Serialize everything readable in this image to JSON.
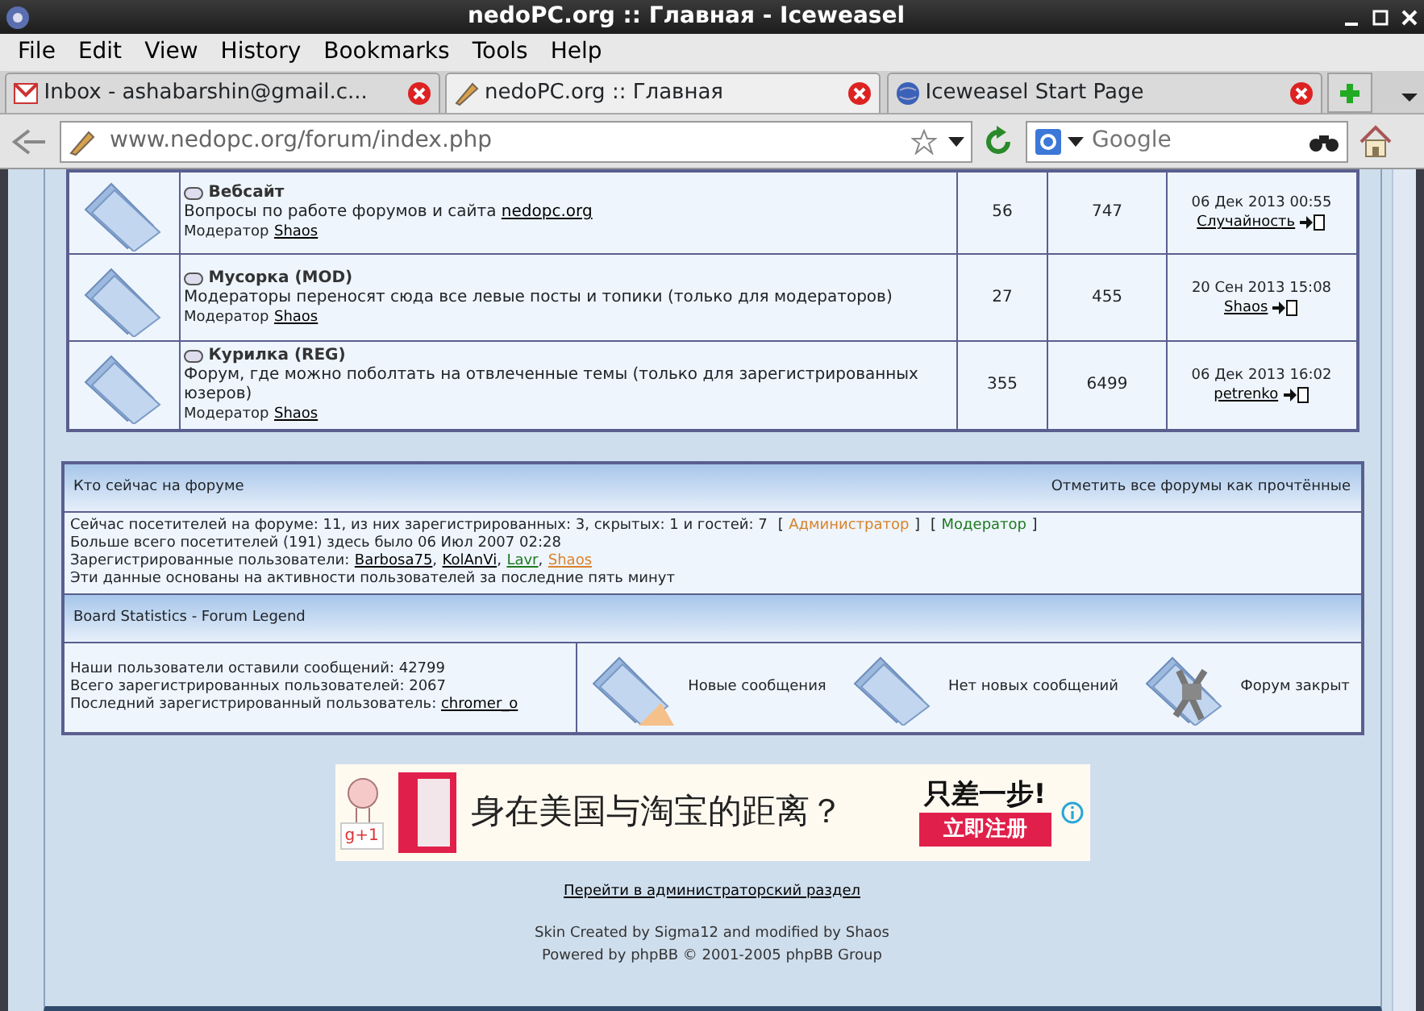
{
  "window": {
    "title": "nedoPC.org :: Главная - Iceweasel"
  },
  "menu": [
    "File",
    "Edit",
    "View",
    "History",
    "Bookmarks",
    "Tools",
    "Help"
  ],
  "tabs": [
    {
      "label": "Inbox - ashabarshin@gmail.c...",
      "selected": false,
      "kind": "mail"
    },
    {
      "label": "nedoPC.org :: Главная",
      "selected": true,
      "kind": "site"
    },
    {
      "label": "Iceweasel Start Page",
      "selected": false,
      "kind": "globe"
    }
  ],
  "address": {
    "value": "www.nedopc.org/forum/index.php"
  },
  "search": {
    "placeholder": "Google"
  },
  "forums": [
    {
      "title": "Вебсайт",
      "description": "Вопросы по работе форумов и сайта ",
      "description_link": "nedopc.org",
      "moderator_label": "Модератор",
      "moderator": "Shaos",
      "topics": "56",
      "posts": "747",
      "last_date": "06 Дек 2013 00:55",
      "last_user": "Случайность"
    },
    {
      "title": "Мусорка (MOD)",
      "description": "Модераторы переносят сюда все левые посты и топики (только для модераторов)",
      "moderator_label": "Модератор",
      "moderator": "Shaos",
      "topics": "27",
      "posts": "455",
      "last_date": "20 Сен 2013 15:08",
      "last_user": "Shaos"
    },
    {
      "title": "Курилка (REG)",
      "description": "Форум, где можно поболтать на отвлеченные темы (только для зарегистрированных юзеров)",
      "moderator_label": "Модератор",
      "moderator": "Shaos",
      "topics": "355",
      "posts": "6499",
      "last_date": "06 Дек 2013 16:02",
      "last_user": "petrenko"
    }
  ],
  "online": {
    "title": "Кто сейчас на форуме",
    "mark_read": "Отметить все форумы как прочтённые",
    "visitors": "Сейчас посетителей на форуме: 11, из них зарегистрированных: 3, скрытых: 1 и гостей: 7",
    "legend": [
      {
        "before": "[",
        "label": "Администратор",
        "after": "]",
        "color": "#d9822b"
      },
      {
        "before": "[",
        "label": "Модератор",
        "after": "]",
        "color": "#1f7a1f"
      }
    ],
    "record": "Больше всего посетителей (191) здесь было 06 Июл 2007 02:28",
    "users_label": "Зарегистрированные пользователи:",
    "users": [
      {
        "name": "Barbosa75",
        "suffix": ",",
        "color": "#000000"
      },
      {
        "name": "KolAnVi",
        "suffix": ",",
        "color": "#000000"
      },
      {
        "name": "Lavr",
        "suffix": ",",
        "color": "#1f7a1f"
      },
      {
        "name": "Shaos",
        "color": "#d9822b"
      }
    ],
    "note": "Эти данные основаны на активности пользователей за последние пять минут"
  },
  "stats": {
    "title": "Board Statistics - Forum Legend",
    "lines": [
      {
        "text": "Наши пользователи оставили сообщений: 42799"
      },
      {
        "text": "Всего зарегистрированных пользователей: 2067"
      },
      {
        "text": "Последний зарегистрированный пользователь: ",
        "link": "chromer_o"
      }
    ],
    "legend": [
      {
        "kind": "new",
        "label": "Новые сообщения"
      },
      {
        "kind": "nonew",
        "label": "Нет новых сообщений"
      },
      {
        "kind": "locked",
        "label": "Форум закрыт"
      }
    ]
  },
  "ad": {
    "plus_one": "g+1",
    "headline": "身在美国与淘宝的距离？",
    "tagline": "只差一步!",
    "cta": "立即注册"
  },
  "admin_link": "Перейти в администраторский раздел",
  "credits": [
    "Skin Created by Sigma12 and modified by Shaos",
    "Powered by phpBB © 2001-2005 phpBB Group"
  ]
}
